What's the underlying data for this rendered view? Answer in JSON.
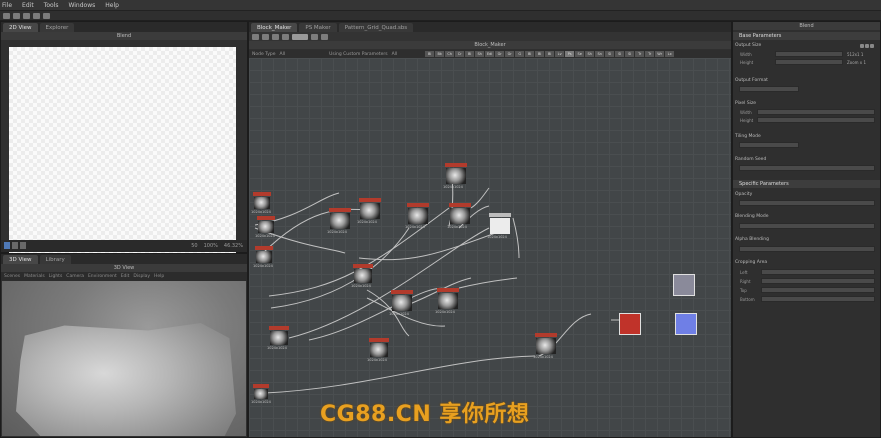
{
  "menubar": {
    "items": [
      "File",
      "Edit",
      "Tools",
      "Windows",
      "Help"
    ]
  },
  "left_top": {
    "tabs": [
      "2D View",
      "Explorer"
    ],
    "title": "Blend",
    "status_values": [
      "50",
      "100%",
      "46.32%"
    ]
  },
  "left_bottom": {
    "tabs": [
      "3D View",
      "Library"
    ],
    "title": "3D View",
    "menu_items": [
      "Scenes",
      "Materials",
      "Lights",
      "Camera",
      "Environment",
      "Edit",
      "Display",
      "Help"
    ]
  },
  "graph": {
    "tabs": [
      "Block_Maker",
      "PS Maker",
      "Pattern_Grid_Quad.sbs"
    ],
    "title": "Block_Maker",
    "params": {
      "node_type_label": "Node Type",
      "node_type_value": "All",
      "params_label": "Using Custom Parameters",
      "params_value": "All"
    },
    "chips": [
      "Bl",
      "Bk",
      "Ch",
      "Cr",
      "Bl",
      "Sh",
      "Edi",
      "Gr",
      "Gr",
      "G",
      "Bl",
      "Bl",
      "Bl",
      "Lv",
      "Ps",
      "Se",
      "Sh",
      "Sn",
      "Sl",
      "Sl",
      "Sl",
      "Tr",
      "Tr",
      "Wr",
      "Lx"
    ],
    "nodes": [
      {
        "label": "1024x1024",
        "kind": "dark"
      },
      {
        "label": "1024x1024",
        "kind": "dark"
      },
      {
        "label": "1024x1024",
        "kind": "dark"
      },
      {
        "label": "1024x1024",
        "kind": "dark"
      },
      {
        "label": "1024x1024",
        "kind": "dark"
      },
      {
        "label": "1024x1024",
        "kind": "dark"
      },
      {
        "label": "1024x1024",
        "kind": "dark"
      },
      {
        "label": "1024x1024",
        "kind": "dark"
      },
      {
        "label": "1024x1024",
        "kind": "dark"
      },
      {
        "label": "1024x1024",
        "kind": "dark"
      },
      {
        "label": "1024x1024",
        "kind": "dark"
      },
      {
        "label": "1024x1024",
        "kind": "dark"
      },
      {
        "label": "1024x1024",
        "kind": "dark"
      },
      {
        "label": "1024x1024",
        "kind": "light"
      },
      {
        "label": "1024x1024",
        "kind": "dark"
      },
      {
        "label": "1024x1024",
        "kind": "dark"
      }
    ]
  },
  "properties": {
    "title": "Blend",
    "base_section": "Base Parameters",
    "output_size": {
      "label": "Output Size",
      "width_label": "Width",
      "height_label": "Height",
      "width_value": "Relative to parent",
      "height_value": "Relative to parent",
      "rel_w": "512x1 1",
      "rel_h": "Zoom x 1"
    },
    "output_format": {
      "label": "Output Format",
      "value": "Relative to parent"
    },
    "pixel_size": {
      "label": "Pixel Size",
      "width_label": "Width",
      "height_label": "Height",
      "width_value": "1",
      "height_value": "1"
    },
    "tiling_mode": {
      "label": "Tiling Mode",
      "value": "Horiz and Vert"
    },
    "random_seed": {
      "label": "Random Seed",
      "value": "0"
    },
    "specific_section": "Specific Parameters",
    "opacity": {
      "label": "Opacity",
      "value": "1"
    },
    "blending_mode": {
      "label": "Blending Mode",
      "value": "Copy"
    },
    "alpha_blending": {
      "label": "Alpha Blending",
      "value": "Use Source Alpha"
    },
    "cropping_area": {
      "label": "Cropping Area",
      "left_label": "Left",
      "right_label": "Right",
      "top_label": "Top",
      "bottom_label": "Bottom",
      "left": "0",
      "right": "1",
      "top": "0",
      "bottom": "1"
    }
  },
  "watermark": "CG88.CN 享你所想",
  "colors": {
    "node_header_red": "#b23b2c",
    "node_red": "#c0332a",
    "node_blue": "#6f7fe6",
    "watermark": "#e8a020"
  }
}
